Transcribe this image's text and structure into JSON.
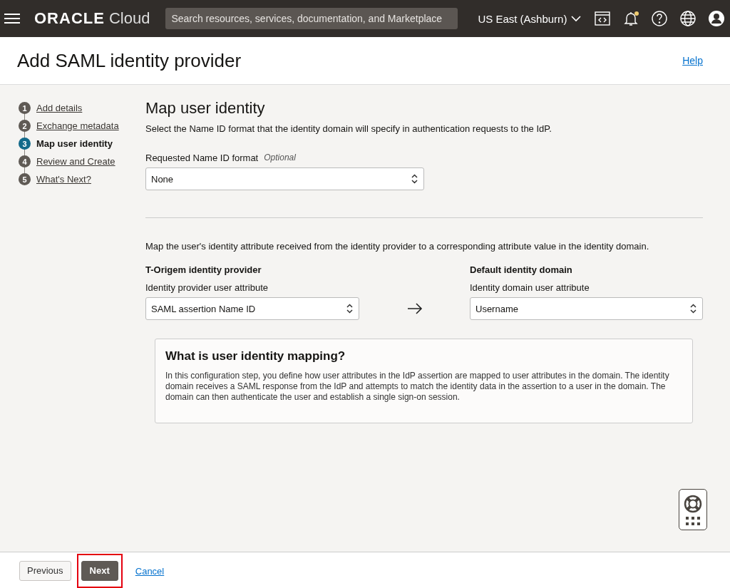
{
  "header": {
    "logo": "ORACLE",
    "logo_suffix": "Cloud",
    "search": {
      "placeholder": "Search resources, services, documentation, and Marketplace"
    },
    "region": "US East (Ashburn)",
    "notification_dot": true
  },
  "page": {
    "title": "Add SAML identity provider",
    "help": "Help"
  },
  "steps": [
    {
      "number": "1",
      "label": "Add details",
      "selected": false
    },
    {
      "number": "2",
      "label": "Exchange metadata",
      "selected": false
    },
    {
      "number": "3",
      "label": "Map user identity",
      "selected": true
    },
    {
      "number": "4",
      "label": "Review and Create",
      "selected": false
    },
    {
      "number": "5",
      "label": "What's Next?",
      "selected": false
    }
  ],
  "section": {
    "title": "Map user identity",
    "description": "Select the Name ID format that the identity domain will specify in authentication requests to the IdP.",
    "name_id": {
      "label": "Requested Name ID format",
      "optional": "Optional",
      "value": "None"
    },
    "mapping_description": "Map the user's identity attribute received from the identity provider to a corresponding attribute value in the identity domain.",
    "source": {
      "heading": "T-Origem identity provider",
      "label": "Identity provider user attribute",
      "value": "SAML assertion Name ID"
    },
    "target": {
      "heading": "Default identity domain",
      "label": "Identity domain user attribute",
      "value": "Username"
    },
    "info": {
      "title": "What is user identity mapping?",
      "body": "In this configuration step, you define how user attributes in the IdP assertion are mapped to user attributes in the domain. The identity domain receives a SAML response from the IdP and attempts to match the identity data in the assertion to a user in the domain. The domain can then authenticate the user and establish a single sign-on session."
    }
  },
  "footer": {
    "buttons": [
      {
        "label": "Previous",
        "kind": "secondary",
        "highlighted": false
      },
      {
        "label": "Next",
        "kind": "primary",
        "highlighted": true
      },
      {
        "label": "Cancel",
        "kind": "link",
        "highlighted": false
      }
    ]
  }
}
